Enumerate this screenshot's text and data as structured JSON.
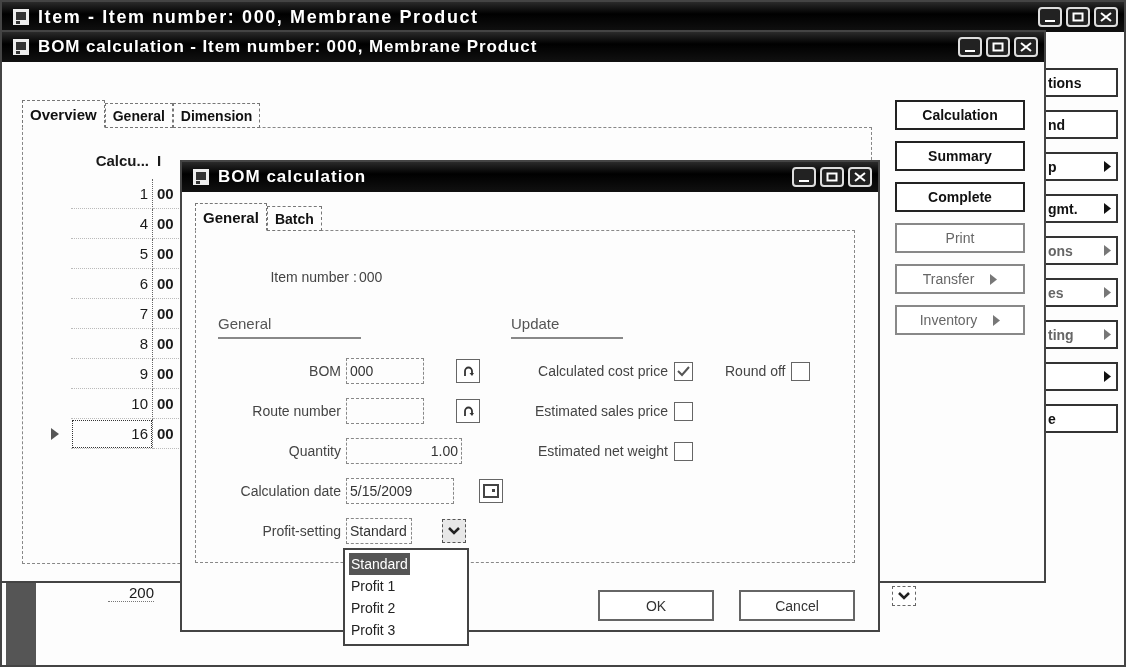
{
  "back_window": {
    "title": "Item - Item number: 000, Membrane Product",
    "buttons": [
      {
        "label": "tions",
        "arrow": false,
        "disabled": false
      },
      {
        "label": "nd",
        "arrow": false,
        "disabled": false
      },
      {
        "label": "p",
        "arrow": true,
        "disabled": false
      },
      {
        "label": "gmt.",
        "arrow": true,
        "disabled": false
      },
      {
        "label": "ons",
        "arrow": true,
        "disabled": true
      },
      {
        "label": "es",
        "arrow": true,
        "disabled": true
      },
      {
        "label": "ting",
        "arrow": true,
        "disabled": true
      },
      {
        "arrow": true,
        "disabled": false
      },
      {
        "label": "e",
        "arrow": false,
        "disabled": false
      }
    ],
    "grid_value": "200"
  },
  "middle_window": {
    "title": "BOM calculation - Item number: 000, Membrane Product",
    "tabs": [
      {
        "label": "Overview",
        "selected": true
      },
      {
        "label": "General",
        "selected": false
      },
      {
        "label": "Dimension",
        "selected": false
      }
    ],
    "grid": {
      "columns": [
        "Calcu...",
        "I"
      ],
      "rows": [
        {
          "cells": [
            "1",
            "00"
          ],
          "current": false
        },
        {
          "cells": [
            "4",
            "00"
          ],
          "current": false
        },
        {
          "cells": [
            "5",
            "00"
          ],
          "current": false
        },
        {
          "cells": [
            "6",
            "00"
          ],
          "current": false
        },
        {
          "cells": [
            "7",
            "00"
          ],
          "current": false
        },
        {
          "cells": [
            "8",
            "00"
          ],
          "current": false
        },
        {
          "cells": [
            "9",
            "00"
          ],
          "current": false
        },
        {
          "cells": [
            "10",
            "00"
          ],
          "current": false
        },
        {
          "cells": [
            "16",
            "00"
          ],
          "current": true
        }
      ]
    },
    "buttons": [
      {
        "label": "Calculation",
        "arrow": false,
        "disabled": false
      },
      {
        "label": "Summary",
        "arrow": false,
        "disabled": false
      },
      {
        "label": "Complete",
        "arrow": false,
        "disabled": false
      },
      {
        "label": "Print",
        "arrow": false,
        "disabled": true
      },
      {
        "label": "Transfer",
        "arrow": true,
        "disabled": true
      },
      {
        "label": "Inventory",
        "arrow": true,
        "disabled": true
      }
    ]
  },
  "dialog": {
    "title": "BOM calculation",
    "tabs": [
      {
        "label": "General",
        "selected": true
      },
      {
        "label": "Batch",
        "selected": false
      }
    ],
    "item_number": {
      "label": "Item number",
      "separator": ":",
      "value": "000"
    },
    "general": {
      "heading": "General",
      "fields": [
        {
          "kind": "lookup",
          "label": "BOM",
          "value": "000"
        },
        {
          "kind": "lookup",
          "label": "Route number"
        },
        {
          "kind": "number",
          "label": "Quantity",
          "value": "1.00"
        },
        {
          "kind": "date",
          "label": "Calculation date",
          "value": "5/15/2009"
        },
        {
          "kind": "select",
          "label": "Profit-setting",
          "value": "Standard",
          "expanded": true,
          "options": [
            {
              "label": "Standard",
              "selected": true
            },
            {
              "label": "Profit 1",
              "selected": false
            },
            {
              "label": "Profit 2",
              "selected": false
            },
            {
              "label": "Profit 3",
              "selected": false
            }
          ]
        }
      ]
    },
    "update": {
      "heading": "Update",
      "options": [
        {
          "label": "Calculated cost price",
          "checked": true
        },
        {
          "label": "Estimated sales price",
          "checked": false
        },
        {
          "label": "Estimated net weight",
          "checked": false
        }
      ],
      "round_off": {
        "label": "Round off",
        "checked": false
      }
    },
    "buttons": [
      "OK",
      "Cancel"
    ]
  }
}
